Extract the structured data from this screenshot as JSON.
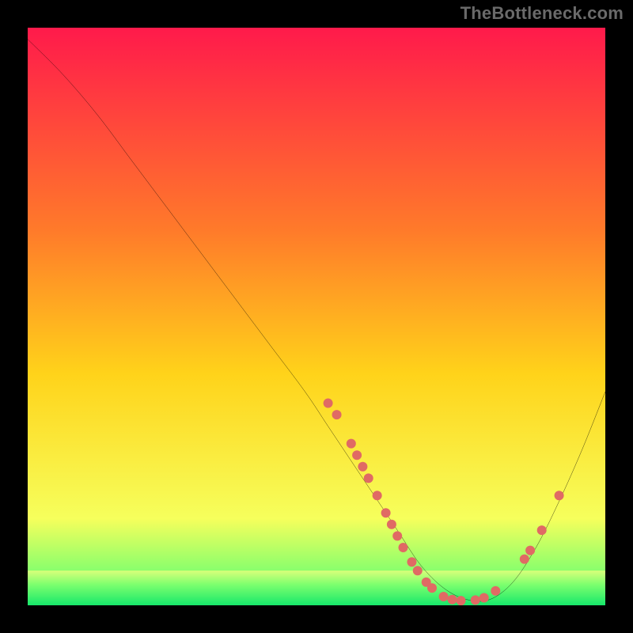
{
  "watermark": "TheBottleneck.com",
  "chart_data": {
    "type": "line",
    "title": "",
    "xlabel": "",
    "ylabel": "",
    "xlim": [
      0,
      100
    ],
    "ylim": [
      0,
      100
    ],
    "grid": false,
    "legend": false,
    "annotations": [],
    "gradient_stops": [
      {
        "offset": 0,
        "color": "#ff1a4b"
      },
      {
        "offset": 35,
        "color": "#ff7a2a"
      },
      {
        "offset": 60,
        "color": "#ffd31a"
      },
      {
        "offset": 85,
        "color": "#f6ff5c"
      },
      {
        "offset": 95,
        "color": "#7dff6e"
      },
      {
        "offset": 100,
        "color": "#17e86b"
      }
    ],
    "green_band_y_range": [
      95,
      100
    ],
    "series": [
      {
        "name": "bottleneck-curve",
        "color": "#000000",
        "x": [
          0,
          6,
          12,
          18,
          24,
          30,
          36,
          42,
          48,
          52,
          56,
          60,
          64,
          68,
          72,
          76,
          80,
          84,
          88,
          92,
          96,
          100
        ],
        "y": [
          98,
          92,
          85,
          77,
          69,
          61,
          53,
          45,
          37,
          31,
          25,
          19,
          13,
          7,
          3,
          1,
          1,
          4,
          10,
          18,
          27,
          37
        ]
      }
    ],
    "marker_points": {
      "color": "#e06a64",
      "radius": 6,
      "points": [
        {
          "x": 52,
          "y": 35
        },
        {
          "x": 53.5,
          "y": 33
        },
        {
          "x": 56,
          "y": 28
        },
        {
          "x": 57,
          "y": 26
        },
        {
          "x": 58,
          "y": 24
        },
        {
          "x": 59,
          "y": 22
        },
        {
          "x": 60.5,
          "y": 19
        },
        {
          "x": 62,
          "y": 16
        },
        {
          "x": 63,
          "y": 14
        },
        {
          "x": 64,
          "y": 12
        },
        {
          "x": 65,
          "y": 10
        },
        {
          "x": 66.5,
          "y": 7.5
        },
        {
          "x": 67.5,
          "y": 6
        },
        {
          "x": 69,
          "y": 4
        },
        {
          "x": 70,
          "y": 3
        },
        {
          "x": 72,
          "y": 1.5
        },
        {
          "x": 73.5,
          "y": 1
        },
        {
          "x": 75,
          "y": 0.8
        },
        {
          "x": 77.5,
          "y": 0.9
        },
        {
          "x": 79,
          "y": 1.3
        },
        {
          "x": 81,
          "y": 2.5
        },
        {
          "x": 86,
          "y": 8
        },
        {
          "x": 87,
          "y": 9.5
        },
        {
          "x": 89,
          "y": 13
        },
        {
          "x": 92,
          "y": 19
        }
      ]
    }
  }
}
